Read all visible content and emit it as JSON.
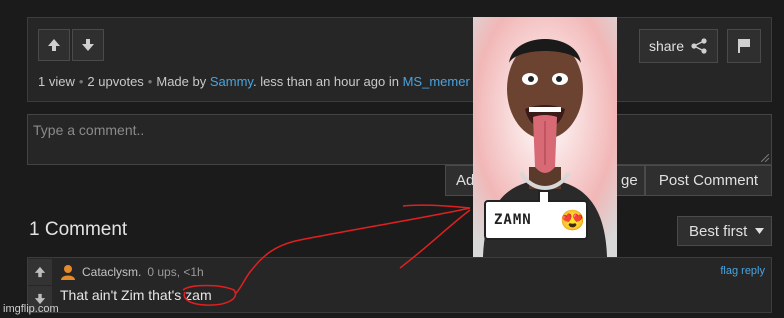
{
  "post": {
    "meta": {
      "views": "1 view",
      "upvotes": "2 upvotes",
      "made_by_prefix": "Made by",
      "author": "Sammy",
      "time": ". less than an hour ago in",
      "stream": "MS_memer"
    },
    "share_label": "share"
  },
  "comment_form": {
    "placeholder": "Type a comment..",
    "add_image_label": "Ad",
    "image_suffix_label": "ge",
    "post_label": "Post Comment"
  },
  "comments": {
    "title": "1 Comment",
    "sort_label": "Best first",
    "items": [
      {
        "username": "Cataclysm.",
        "stats": "0 ups, <1h",
        "actions": "flag reply",
        "text": "That ain't Zim that's zam"
      }
    ]
  },
  "overlay": {
    "sticker_text": "ZAMN",
    "emoji": "😍"
  },
  "watermark": "imgflip.com",
  "colors": {
    "background": "#1b1b1b",
    "panel": "#262626",
    "link": "#4aa3df",
    "annotation": "#e02020"
  }
}
